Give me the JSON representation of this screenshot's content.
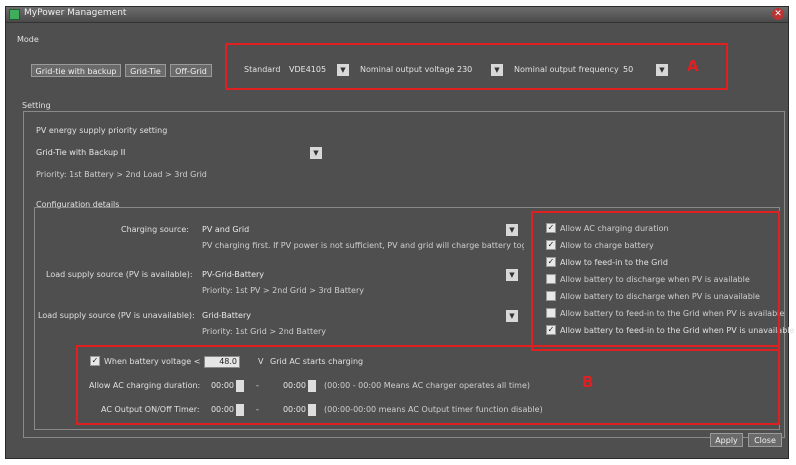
{
  "window": {
    "title": "MyPower Management"
  },
  "mode": {
    "section_label": "Mode",
    "buttons": [
      "Grid-tie with backup",
      "Grid-Tie",
      "Off-Grid"
    ],
    "standard_label": "Standard",
    "standard_value": "VDE4105",
    "voltage_label": "Nominal output voltage",
    "voltage_value": "230",
    "frequency_label": "Nominal output frequency",
    "frequency_value": "50",
    "annotation": "A"
  },
  "setting": {
    "section_label": "Setting",
    "pv_supply_label": "PV energy supply priority setting",
    "pv_supply_value": "Grid-Tie with Backup II",
    "priority_text": "Priority: 1st Battery > 2nd Load > 3rd Grid"
  },
  "config": {
    "section_label": "Configuration details",
    "charging_label": "Charging source:",
    "charging_value": "PV and Grid",
    "charging_note": "PV charging first. If PV power is not sufficient, PV and grid will charge battery together.",
    "load_avail_label": "Load supply source (PV is available):",
    "load_avail_value": "PV-Grid-Battery",
    "load_avail_note": "Priority: 1st PV > 2nd Grid > 3rd Battery",
    "load_unavail_label": "Load supply source (PV is unavailable):",
    "load_unavail_value": "Grid-Battery",
    "load_unavail_note": "Priority: 1st Grid > 2nd Battery",
    "options": [
      {
        "label": "Allow AC charging duration",
        "checked": true
      },
      {
        "label": "Allow to charge battery",
        "checked": true
      },
      {
        "label": "Allow to feed-in to the Grid",
        "checked": true
      },
      {
        "label": "Allow battery to discharge when PV is available",
        "checked": false
      },
      {
        "label": "Allow battery to discharge when PV is unavailable",
        "checked": false
      },
      {
        "label": "Allow battery to feed-in to the Grid when PV is available",
        "checked": false
      },
      {
        "label": "Allow battery to feed-in to the Grid when PV is unavailable",
        "checked": true
      }
    ],
    "battery_check_label": "When battery voltage <",
    "battery_voltage": "48.0",
    "battery_unit": "V",
    "battery_tail": "Grid AC starts charging",
    "ac_charging_label": "Allow AC charging duration:",
    "ac_start": "00:00",
    "ac_end": "00:00",
    "ac_note": "(00:00 - 00:00 Means AC charger operates all time)",
    "ac_output_label": "AC Output ON/Off Timer:",
    "out_start": "00:00",
    "out_end": "00:00",
    "out_note": "(00:00-00:00 means AC Output timer function disable)",
    "annotation": "B",
    "dash": "-"
  },
  "footer": {
    "apply_label": "Apply",
    "close_label": "Close"
  }
}
